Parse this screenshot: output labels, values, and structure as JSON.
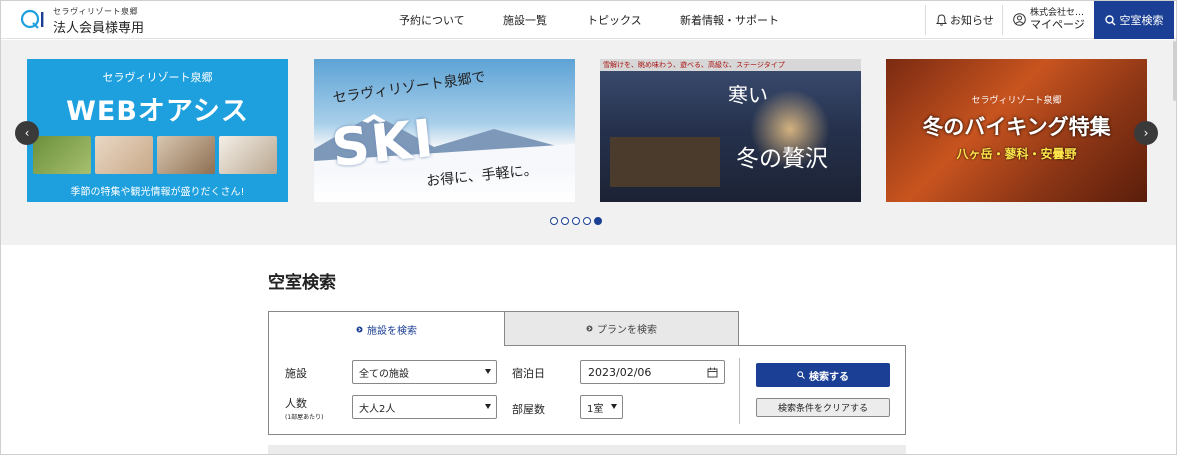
{
  "header": {
    "brand_sub": "セラヴィリゾート泉郷",
    "brand_main": "法人会員様専用",
    "nav": [
      "予約について",
      "施設一覧",
      "トピックス",
      "新着情報・サポート"
    ],
    "notice_label": "お知らせ",
    "company_label": "株式会社セ…",
    "mypage_label": "マイページ",
    "vacancy_button": "空室検索"
  },
  "carousel": {
    "slides": [
      {
        "line1": "セラヴィリゾート泉郷",
        "title": "WEBオアシス",
        "caption": "季節の特集や観光情報が盛りだくさん!"
      },
      {
        "line1": "セラヴィリゾート泉郷で",
        "title": "SKI",
        "caption": "お得に、手軽に。"
      },
      {
        "banner": "雪解けを、眺め味わう、遊べる、高級な、ステージタイプ",
        "title1": "寒い",
        "title2": "冬の贅沢"
      },
      {
        "line1": "セラヴィリゾート泉郷",
        "title": "冬のバイキング特集",
        "caption": "八ヶ岳・蓼科・安曇野"
      }
    ],
    "dot_count": 5,
    "active_dot": 5,
    "prev_icon": "chevron-left-icon",
    "next_icon": "chevron-right-icon"
  },
  "search": {
    "title": "空室検索",
    "tabs": [
      "施設を検索",
      "プランを検索"
    ],
    "active_tab": 0,
    "facility_label": "施設",
    "facility_value": "全ての施設",
    "people_label": "人数",
    "people_note": "(1部屋あたり)",
    "people_value": "大人2人",
    "date_label": "宿泊日",
    "date_value": "2023/02/06",
    "rooms_label": "部屋数",
    "rooms_value": "1室",
    "search_button": "検索する",
    "clear_button": "検索条件をクリアする"
  },
  "colors": {
    "brand_blue": "#1b3f94",
    "slide1_bg": "#1ea0df"
  }
}
